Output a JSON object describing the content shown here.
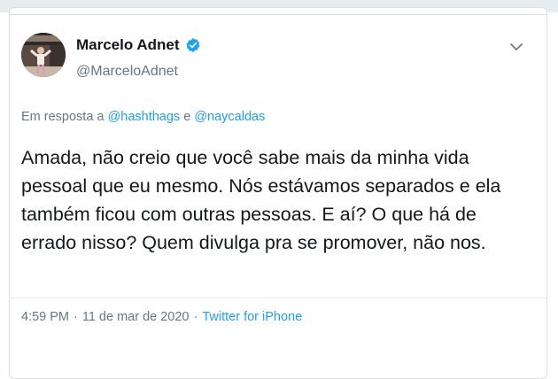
{
  "tweet": {
    "display_name": "Marcelo Adnet",
    "handle": "@MarceloAdnet",
    "verified_icon": "verified-badge-icon",
    "reply_prefix": "Em resposta a",
    "reply_mention_1": "@hashthags",
    "reply_joiner": "e",
    "reply_mention_2": "@naycaldas",
    "text": "Amada, não creio que você sabe mais da minha vida\npessoal que eu mesmo. Nós estávamos separados e ela\ntambém ficou com outras pessoas. E aí? O que há de\nerrado nisso? Quem divulga pra se promover, não nos.",
    "time": "4:59 PM",
    "separator_1": "·",
    "date": "11 de mar de 2020",
    "separator_2": "·",
    "source": "Twitter for iPhone"
  },
  "colors": {
    "link": "#1da1f2",
    "muted": "#657786",
    "text": "#14171a"
  }
}
